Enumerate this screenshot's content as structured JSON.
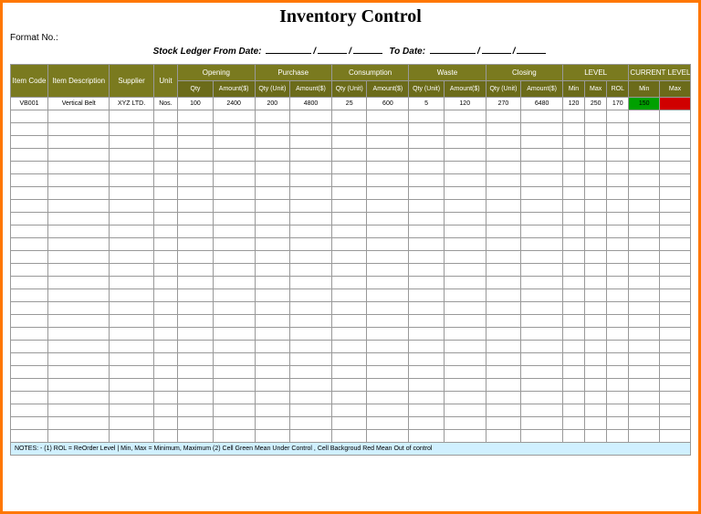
{
  "title": "Inventory Control",
  "format_label": "Format No.:",
  "ledger": {
    "prefix": "Stock Ledger From Date:",
    "to": "To Date:"
  },
  "headers": {
    "item_code": "Item Code",
    "item_desc": "Item Description",
    "supplier": "Supplier",
    "unit": "Unit",
    "opening": "Opening",
    "purchase": "Purchase",
    "consumption": "Consumption",
    "waste": "Waste",
    "closing": "Closing",
    "level": "LEVEL",
    "current_level": "CURRENT LEVEL",
    "qty": "Qty",
    "amount": "Amount($)",
    "qty_unit": "Qty (Unit)",
    "min": "Min",
    "max": "Max",
    "rol": "ROL"
  },
  "row": {
    "code": "VB001",
    "desc": "Vertical Belt",
    "supplier": "XYZ LTD.",
    "unit": "Nos.",
    "open_qty": "100",
    "open_amt": "2400",
    "pur_qty": "200",
    "pur_amt": "4800",
    "con_qty": "25",
    "con_amt": "600",
    "waste_qty": "5",
    "waste_amt": "120",
    "close_qty": "270",
    "close_amt": "6480",
    "lvl_min": "120",
    "lvl_max": "250",
    "lvl_rol": "170",
    "cur_min": "150",
    "cur_max": ""
  },
  "notes": "NOTES: - (1) ROL = ReOrder Level | Min, Max = Minimum, Maximum    (2) Cell Green Mean Under Control , Cell Backgroud Red Mean Out of control",
  "empty_rows": 26
}
